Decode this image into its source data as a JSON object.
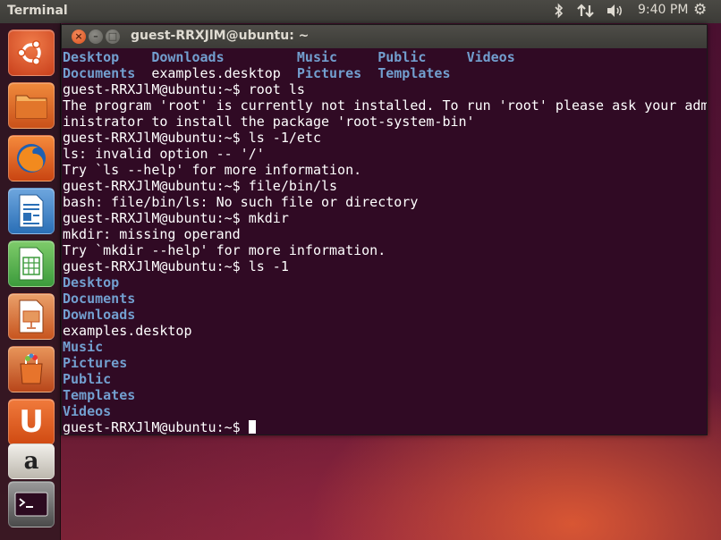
{
  "top_panel": {
    "app_name": "Terminal",
    "icons": [
      "bluetooth-icon",
      "network-icon",
      "volume-icon",
      "gear-icon"
    ],
    "clock": "9:40 PM"
  },
  "launcher": {
    "items": [
      {
        "name": "dash-home",
        "icon": "ubuntu-logo-icon",
        "color": "#e35b2c"
      },
      {
        "name": "files",
        "icon": "folder-icon",
        "color": "#e0661f"
      },
      {
        "name": "firefox",
        "icon": "firefox-icon",
        "color": "#e66000"
      },
      {
        "name": "libreoffice-writer",
        "icon": "writer-icon",
        "color": "#2a6fb6"
      },
      {
        "name": "libreoffice-calc",
        "icon": "calc-icon",
        "color": "#3c9b3c"
      },
      {
        "name": "libreoffice-impress",
        "icon": "impress-icon",
        "color": "#c7551f"
      },
      {
        "name": "software-center",
        "icon": "shopping-bag-icon",
        "color": "#d86b2a"
      },
      {
        "name": "ubuntu-one",
        "icon": "ubuntu-one-icon",
        "color": "#e65c1f"
      },
      {
        "name": "amazon",
        "icon": "amazon-icon",
        "color": "#d7d3cc"
      },
      {
        "name": "terminal",
        "icon": "terminal-icon",
        "color": "#3a3a3a"
      }
    ]
  },
  "terminal": {
    "window_title": "guest-RRXJlM@ubuntu: ~",
    "colors": {
      "background": "#300a24",
      "text": "#ffffff",
      "directory": "#729fcf"
    },
    "lines": [
      [
        {
          "t": "Desktop",
          "k": "dir"
        },
        {
          "t": "    ",
          "k": "file"
        },
        {
          "t": "Downloads",
          "k": "dir"
        },
        {
          "t": "         ",
          "k": "file"
        },
        {
          "t": "Music",
          "k": "dir"
        },
        {
          "t": "     ",
          "k": "file"
        },
        {
          "t": "Public",
          "k": "dir"
        },
        {
          "t": "     ",
          "k": "file"
        },
        {
          "t": "Videos",
          "k": "dir"
        }
      ],
      [
        {
          "t": "Documents",
          "k": "dir"
        },
        {
          "t": "  examples.desktop  ",
          "k": "file"
        },
        {
          "t": "Pictures",
          "k": "dir"
        },
        {
          "t": "  ",
          "k": "file"
        },
        {
          "t": "Templates",
          "k": "dir"
        }
      ],
      [
        {
          "t": "guest-RRXJlM@ubuntu:~$ root ls",
          "k": "file"
        }
      ],
      [
        {
          "t": "The program 'root' is currently not installed. To run 'root' please ask your adm",
          "k": "file"
        }
      ],
      [
        {
          "t": "inistrator to install the package 'root-system-bin'",
          "k": "file"
        }
      ],
      [
        {
          "t": "guest-RRXJlM@ubuntu:~$ ls -1/etc",
          "k": "file"
        }
      ],
      [
        {
          "t": "ls: invalid option -- '/'",
          "k": "file"
        }
      ],
      [
        {
          "t": "Try `ls --help' for more information.",
          "k": "file"
        }
      ],
      [
        {
          "t": "guest-RRXJlM@ubuntu:~$ file/bin/ls",
          "k": "file"
        }
      ],
      [
        {
          "t": "bash: file/bin/ls: No such file or directory",
          "k": "file"
        }
      ],
      [
        {
          "t": "guest-RRXJlM@ubuntu:~$ mkdir",
          "k": "file"
        }
      ],
      [
        {
          "t": "mkdir: missing operand",
          "k": "file"
        }
      ],
      [
        {
          "t": "Try `mkdir --help' for more information.",
          "k": "file"
        }
      ],
      [
        {
          "t": "guest-RRXJlM@ubuntu:~$ ls -1",
          "k": "file"
        }
      ],
      [
        {
          "t": "Desktop",
          "k": "dir"
        }
      ],
      [
        {
          "t": "Documents",
          "k": "dir"
        }
      ],
      [
        {
          "t": "Downloads",
          "k": "dir"
        }
      ],
      [
        {
          "t": "examples.desktop",
          "k": "file"
        }
      ],
      [
        {
          "t": "Music",
          "k": "dir"
        }
      ],
      [
        {
          "t": "Pictures",
          "k": "dir"
        }
      ],
      [
        {
          "t": "Public",
          "k": "dir"
        }
      ],
      [
        {
          "t": "Templates",
          "k": "dir"
        }
      ],
      [
        {
          "t": "Videos",
          "k": "dir"
        }
      ]
    ],
    "prompt": "guest-RRXJlM@ubuntu:~$ "
  }
}
